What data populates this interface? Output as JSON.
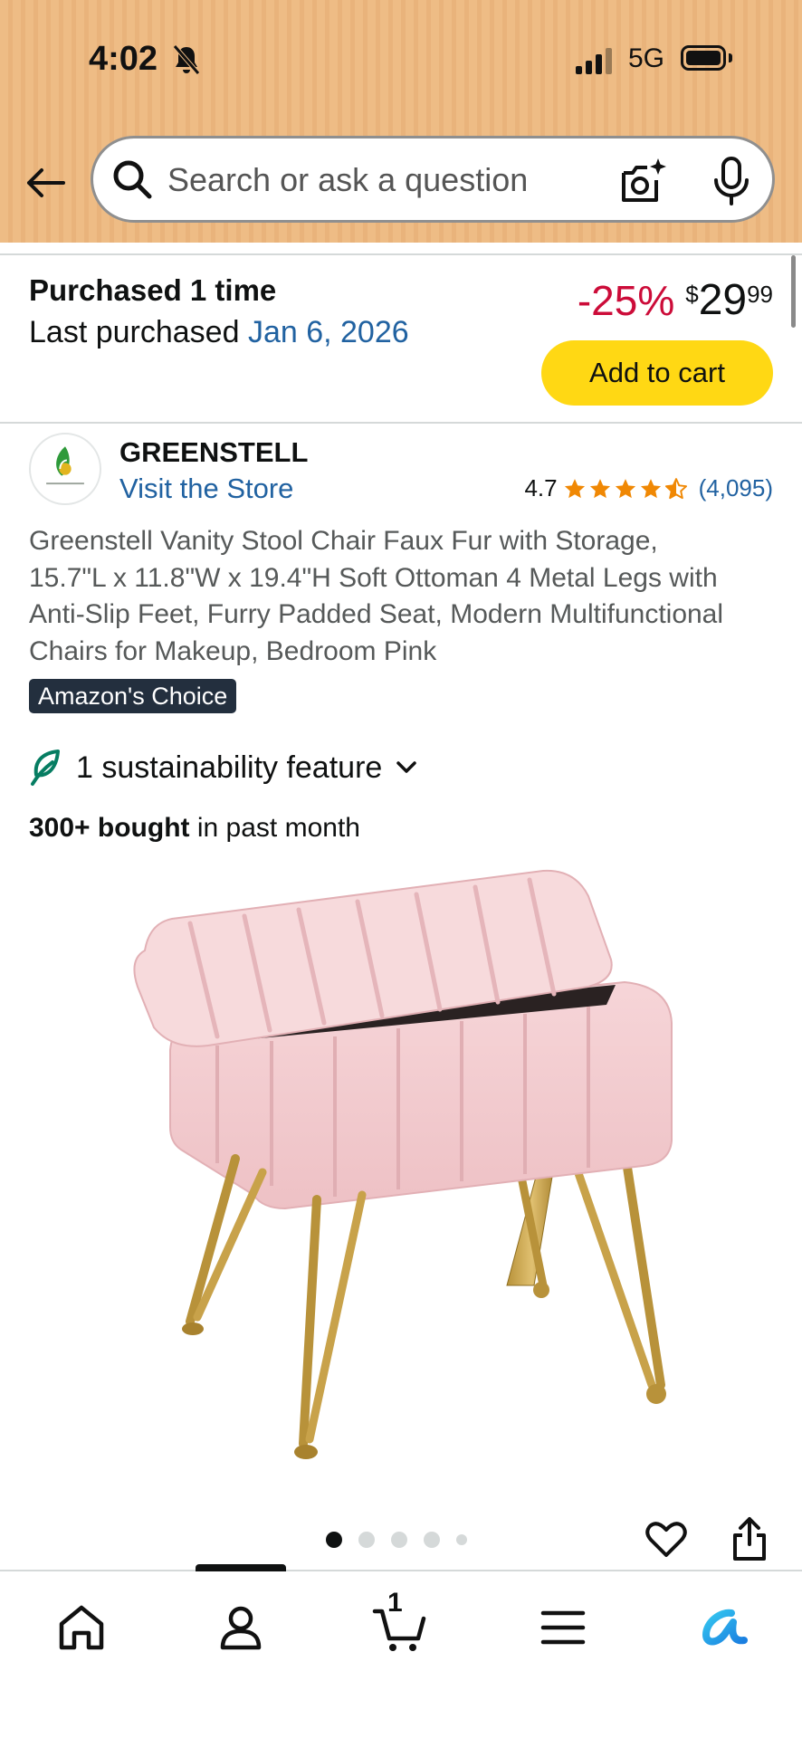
{
  "status_bar": {
    "time": "4:02",
    "network": "5G"
  },
  "search": {
    "placeholder": "Search or ask a question"
  },
  "purchase_info": {
    "title": "Purchased 1 time",
    "last_label": "Last purchased ",
    "last_date": "Jan 6, 2026"
  },
  "price": {
    "discount": "-25%",
    "currency": "$",
    "whole": "29",
    "fraction": "99"
  },
  "add_to_cart_label": "Add to cart",
  "brand": {
    "name": "GREENSTELL",
    "visit_store": "Visit the Store",
    "rating": "4.7",
    "stars": 4.7,
    "review_count": "(4,095)"
  },
  "product": {
    "title": "Greenstell Vanity Stool Chair Faux Fur with Storage, 15.7\"L x 11.8\"W x 19.4\"H Soft Ottoman 4 Metal Legs with Anti-Slip Feet, Furry Padded Seat, Modern Multifunctional Chairs for Makeup, Bedroom Pink",
    "badge": "Amazon's Choice",
    "sustainability": "1 sustainability feature",
    "bought_bold": "300+ bought",
    "bought_rest": " in past month",
    "image_count": 5,
    "current_image": 1
  },
  "bottom_nav": {
    "items": [
      "home-icon",
      "account-icon",
      "cart-icon",
      "menu-icon",
      "rufus-icon"
    ],
    "cart_count": "1",
    "active": "account"
  },
  "colors": {
    "header": "#eebc85",
    "link": "#2162a1",
    "discount": "#cc0c39",
    "cart_button": "#ffd814",
    "star": "#f08804",
    "badge_bg": "#232f3e"
  }
}
